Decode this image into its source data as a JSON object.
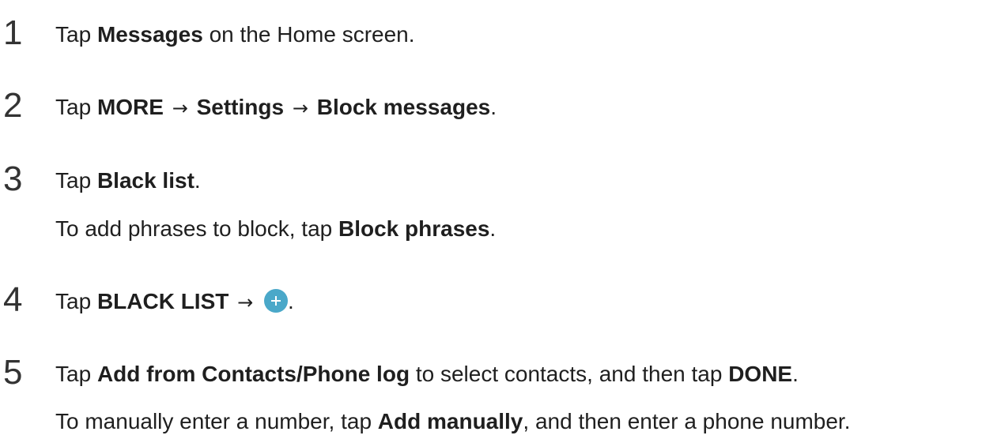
{
  "steps": [
    {
      "number": "1",
      "lines": [
        {
          "t1": "Tap ",
          "b1": "Messages",
          "t2": " on the Home screen."
        }
      ]
    },
    {
      "number": "2",
      "lines": [
        {
          "t1": "Tap ",
          "b1": "MORE",
          "arrow1": "→",
          "b2": "Settings",
          "arrow2": "→",
          "b3": "Block messages",
          "t2": "."
        }
      ]
    },
    {
      "number": "3",
      "lines": [
        {
          "t1": "Tap ",
          "b1": "Black list",
          "t2": "."
        },
        {
          "t1": "To add phrases to block, tap ",
          "b1": "Block phrases",
          "t2": "."
        }
      ]
    },
    {
      "number": "4",
      "lines": [
        {
          "t1": "Tap ",
          "b1": "BLACK LIST",
          "arrow1": "→",
          "icon": "plus-circle-icon",
          "t2": "."
        }
      ]
    },
    {
      "number": "5",
      "lines": [
        {
          "t1": "Tap ",
          "b1": "Add from Contacts/Phone log",
          "t2": " to select contacts, and then tap ",
          "b2": "DONE",
          "t3": "."
        },
        {
          "t1": "To manually enter a number, tap ",
          "b1": "Add manually",
          "t2": ", and then enter a phone number."
        }
      ]
    }
  ],
  "colors": {
    "text": "#1f1f1f",
    "number": "#333333",
    "icon_accent": "#4aa8c9"
  }
}
